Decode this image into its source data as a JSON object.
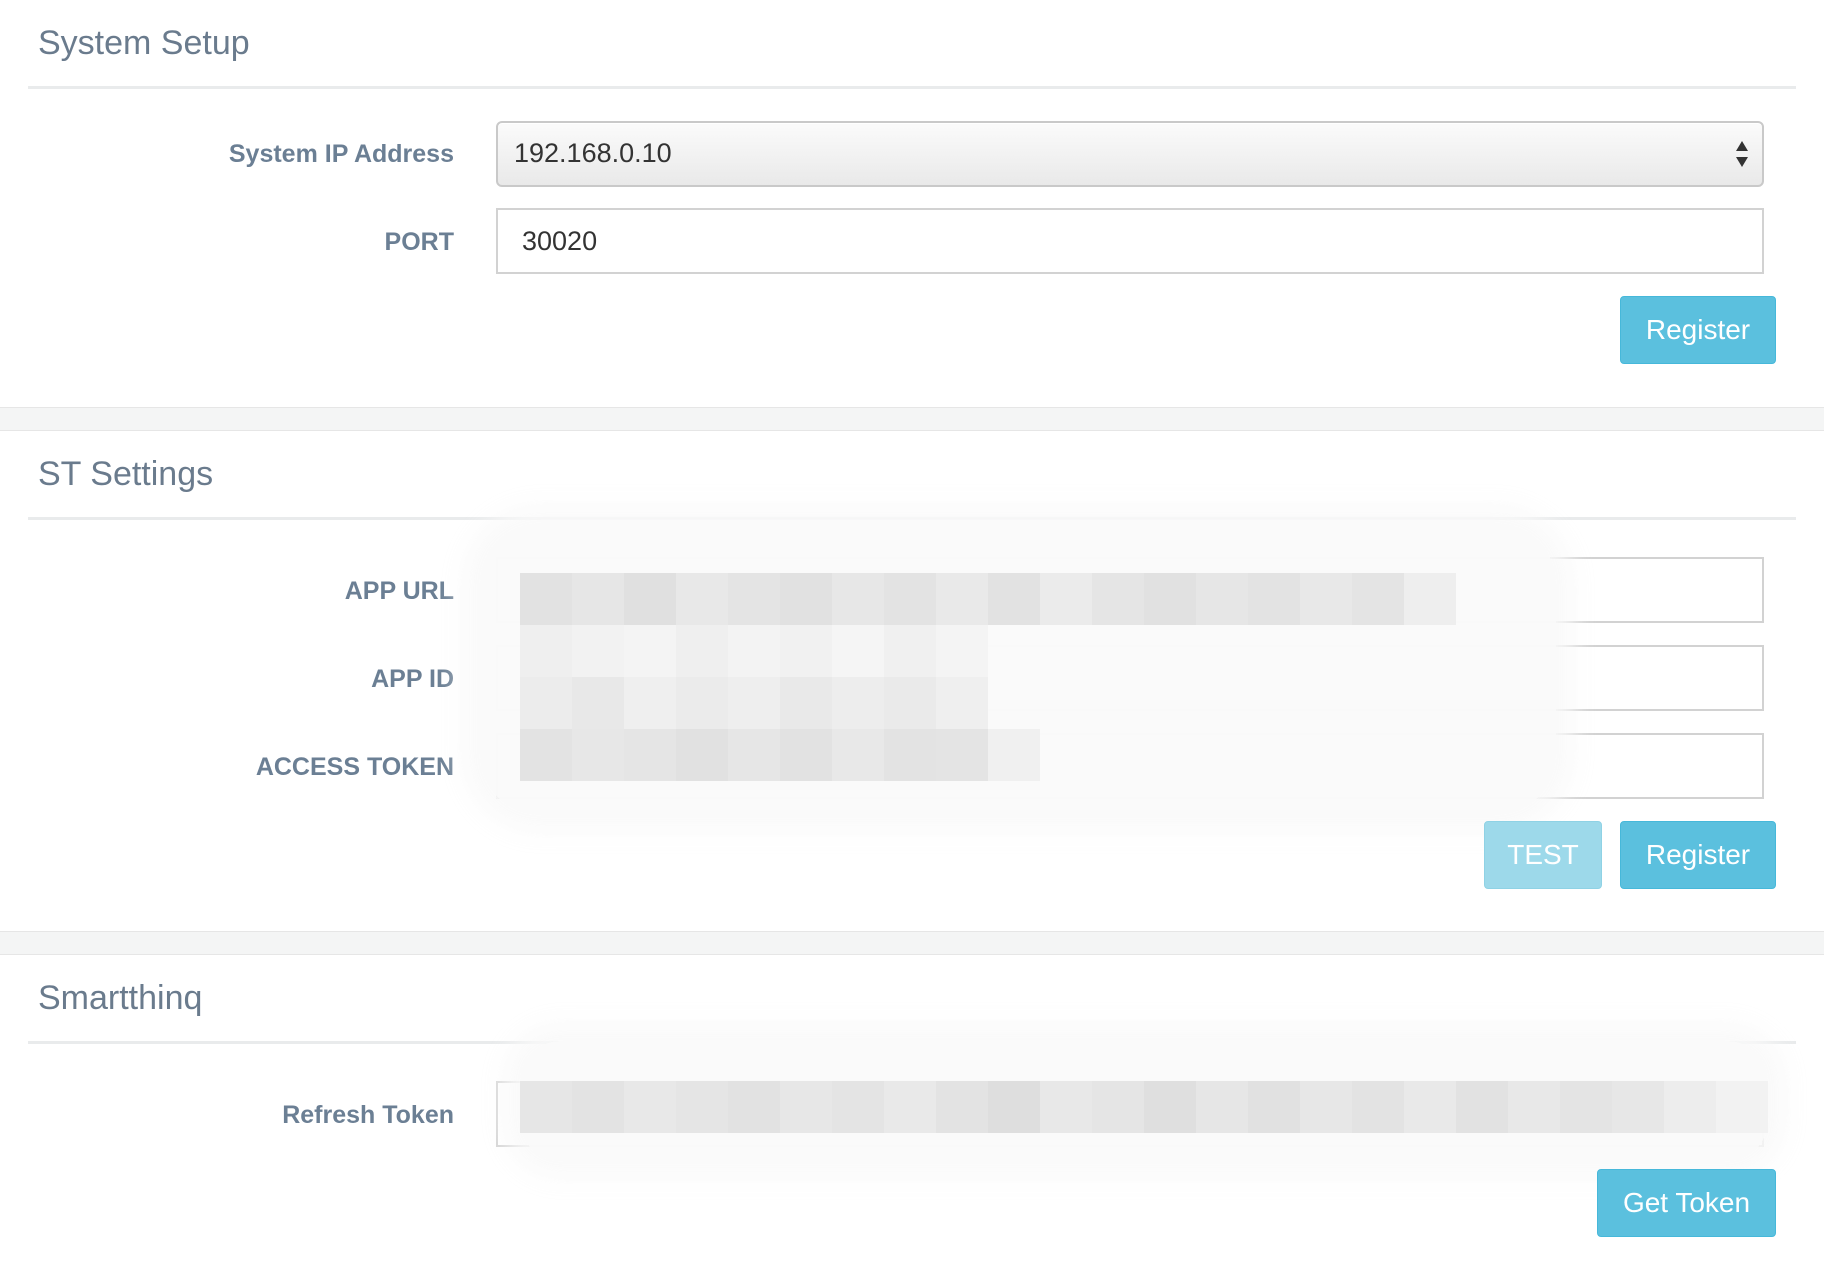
{
  "system_setup": {
    "title": "System Setup",
    "ip_label": "System IP Address",
    "ip_value": "192.168.0.10",
    "port_label": "PORT",
    "port_value": "30020",
    "register_label": "Register"
  },
  "st_settings": {
    "title": "ST Settings",
    "app_url_label": "APP URL",
    "app_id_label": "APP ID",
    "access_token_label": "ACCESS TOKEN",
    "test_label": "TEST",
    "register_label": "Register"
  },
  "smartthinq": {
    "title": "Smartthinq",
    "refresh_token_label": "Refresh Token",
    "get_token_label": "Get Token"
  },
  "colors": {
    "accent": "#5bc0de",
    "accent_disabled": "#9dd9ea",
    "label": "#6b7f94",
    "title": "#6a7b8d"
  },
  "icons": {
    "select_arrows": "up-down-arrows-icon"
  }
}
